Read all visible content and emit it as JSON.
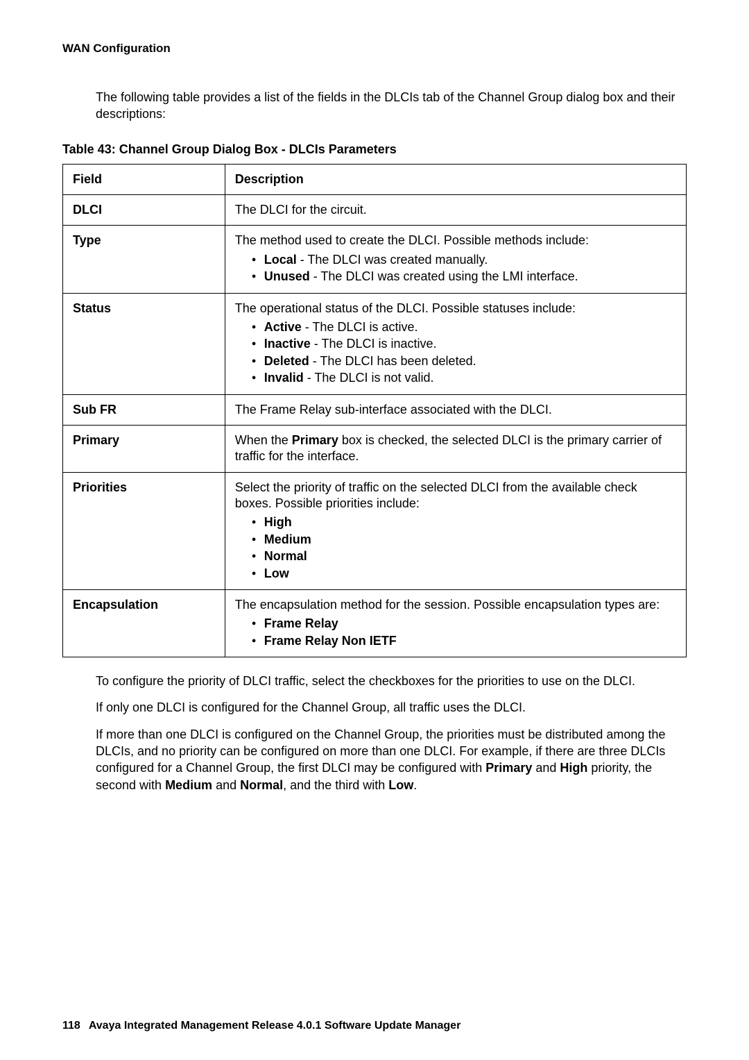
{
  "running_head": "WAN Configuration",
  "intro": "The following table provides a list of the fields in the DLCIs tab of the Channel Group dialog box and their descriptions:",
  "table_caption": "Table 43: Channel Group Dialog Box - DLCIs Parameters",
  "header": {
    "field": "Field",
    "description": "Description"
  },
  "rows": {
    "dlci": {
      "field": "DLCI",
      "desc": "The DLCI for the circuit."
    },
    "type": {
      "field": "Type",
      "desc_lead": "The method used to create the DLCI. Possible methods include:",
      "items": {
        "local": {
          "bold": "Local",
          "rest": " - The DLCI was created manually."
        },
        "unused": {
          "bold": "Unused",
          "rest": " - The DLCI was created using the LMI interface."
        }
      }
    },
    "status": {
      "field": "Status",
      "desc_lead": "The operational status of the DLCI. Possible statuses include:",
      "items": {
        "active": {
          "bold": "Active",
          "rest": " - The DLCI is active."
        },
        "inactive": {
          "bold": "Inactive",
          "rest": " - The DLCI is inactive."
        },
        "deleted": {
          "bold": "Deleted",
          "rest": " - The DLCI has been deleted."
        },
        "invalid": {
          "bold": "Invalid",
          "rest": " - The DLCI is not valid."
        }
      }
    },
    "subfr": {
      "field": "Sub FR",
      "desc": "The Frame Relay sub-interface associated with the DLCI."
    },
    "primary": {
      "field": "Primary",
      "desc_pre": "When the ",
      "desc_bold": "Primary",
      "desc_post": " box is checked, the selected DLCI is the primary carrier of traffic for the interface."
    },
    "priorities": {
      "field": "Priorities",
      "desc_lead": "Select the priority of traffic on the selected DLCI from the available check boxes. Possible priorities include:",
      "items": {
        "high": {
          "bold": "High"
        },
        "medium": {
          "bold": "Medium"
        },
        "normal": {
          "bold": "Normal"
        },
        "low": {
          "bold": "Low"
        }
      }
    },
    "encapsulation": {
      "field": "Encapsulation",
      "desc_lead": "The encapsulation method for the session. Possible encapsulation types are:",
      "items": {
        "fr": {
          "bold": "Frame Relay"
        },
        "frnon": {
          "bold": "Frame Relay Non IETF"
        }
      }
    }
  },
  "after": {
    "p1": "To configure the priority of DLCI traffic, select the checkboxes for the priorities to use on the DLCI.",
    "p2": "If only one DLCI is configured for the Channel Group, all traffic uses the DLCI.",
    "p3_1": "If more than one DLCI is configured on the Channel Group, the priorities must be distributed among the DLCIs, and no priority can be configured on more than one DLCI. For example, if there are three DLCIs configured for a Channel Group, the first DLCI may be configured with ",
    "p3_b1": "Primary",
    "p3_2": " and ",
    "p3_b2": "High",
    "p3_3": " priority, the second with ",
    "p3_b3": "Medium",
    "p3_4": " and ",
    "p3_b4": "Normal",
    "p3_5": ", and the third with ",
    "p3_b5": "Low",
    "p3_6": "."
  },
  "footer": {
    "page": "118",
    "title": "Avaya Integrated Management Release 4.0.1 Software Update Manager"
  }
}
